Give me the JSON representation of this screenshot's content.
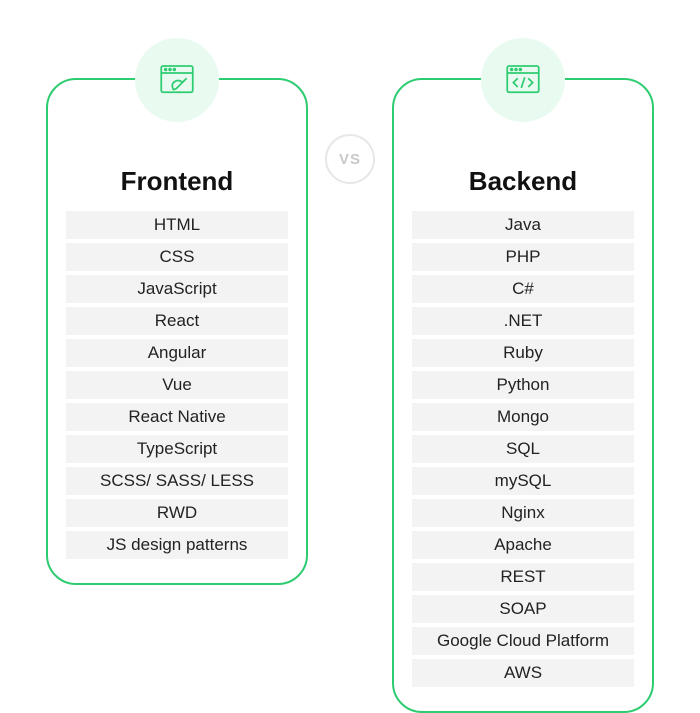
{
  "vs_label": "vs",
  "frontend": {
    "title": "Frontend",
    "icon": "design-icon",
    "items": [
      "HTML",
      "CSS",
      "JavaScript",
      "React",
      "Angular",
      "Vue",
      "React Native",
      "TypeScript",
      "SCSS/ SASS/ LESS",
      "RWD",
      "JS design patterns"
    ]
  },
  "backend": {
    "title": "Backend",
    "icon": "code-icon",
    "items": [
      "Java",
      "PHP",
      "C#",
      ".NET",
      "Ruby",
      "Python",
      "Mongo",
      "SQL",
      "mySQL",
      "Nginx",
      "Apache",
      "REST",
      "SOAP",
      "Google Cloud Platform",
      "AWS"
    ]
  }
}
